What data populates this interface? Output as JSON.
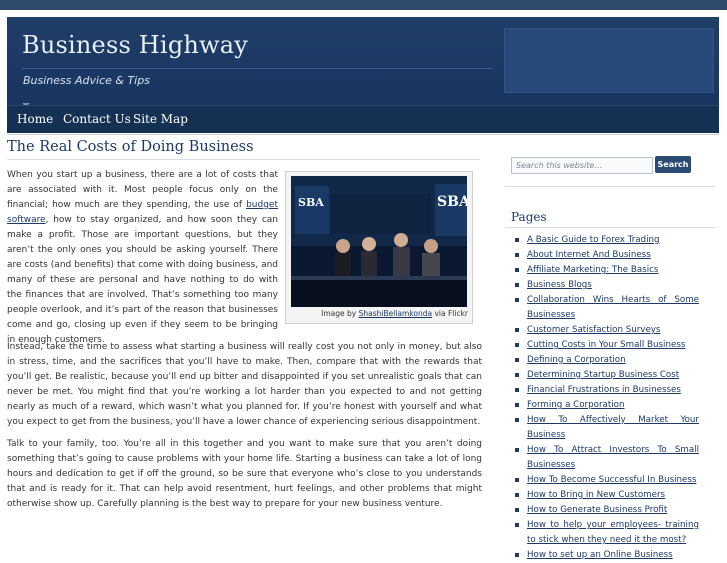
{
  "header": {
    "site_title": "Business Highway",
    "tagline": "Business Advice & Tips"
  },
  "nav": {
    "items": [
      "Home",
      "Contact Us",
      "Site Map"
    ]
  },
  "post": {
    "title": "The Real Costs of Doing Business",
    "p1_part1": "When you start up a business, there are a lot of costs that are associated with it. Most people focus only on the financial; how much are they spending, the use of ",
    "p1_link": "budget software",
    "p1_part2": ", how to stay organized, and how soon they can make a profit. Those are important questions, but they aren’t the only ones you should be asking yourself. There are costs (and benefits) that come with doing business, and many of these are personal and have nothing to do with the finances that are involved. That’s something too many people overlook, and it’s part of the reason that businesses come and go, closing up even if they seem to be bringing in enough customers.",
    "p2": "Instead, take the time to assess what starting a business will really cost you not only in money, but also in stress, time, and the sacrifices that you’ll have to make. Then, compare that with the rewards that you’ll get. Be realistic, because you’ll end up bitter and disappointed if you set unrealistic goals that can never be met. You might find that you’re working a lot harder than you expected to and not getting nearly as much of a reward, which wasn’t what you planned for. If you’re honest with yourself and what you expect to get from the business, you’ll have a lower chance of experiencing serious disappointment.",
    "p3": "Talk to your family, too. You’re all in this together and you want to make sure that you aren’t doing something that’s going to cause problems with your home life. Starting a business can take a lot of long hours and dedication to get if off the ground, so be sure that everyone who’s close to you understands that and is ready for it. That can help avoid resentment, hurt feelings, and other problems that might otherwise show up. Carefully planning is the best way to prepare for your new business venture."
  },
  "figure": {
    "sign_text": "SBA",
    "caption_prefix": "Image by ",
    "caption_author": "ShashiBellamkonda",
    "caption_suffix": " via Flickr"
  },
  "sidebar": {
    "search_placeholder": "Search this website…",
    "search_button": "Search",
    "pages_heading": "Pages",
    "pages": [
      "A Basic Guide to Forex Trading",
      "About Internet And Business",
      "Affiliate Marketing: The Basics",
      "Business Blogs",
      "Collaboration Wins Hearts of Some Businesses",
      "Customer Satisfaction Surveys",
      "Cutting Costs in Your Small Business",
      "Defining a Corporation",
      "Determining Startup Business Cost",
      "Financial Frustrations in Businesses",
      "Forming a Corporation",
      "How To Affectively Market Your Business",
      "How To Attract Investors To Small Businesses",
      "How To Become Successful In Business",
      "How to Bring in New Customers",
      "How to Generate Business Profit",
      "How to help your employees- training to stick when they need it the most?",
      "How to set up an Online Business"
    ]
  },
  "colors": {
    "header_bg": "#1f3e68",
    "nav_bg": "#143052",
    "accent": "#1d3a66"
  }
}
